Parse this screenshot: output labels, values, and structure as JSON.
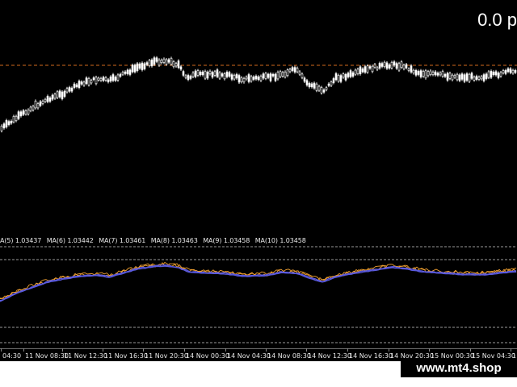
{
  "profit_label": "0.0 p",
  "ma_legend": [
    "A(5) 1.03437",
    "MA(6) 1.03442",
    "MA(7) 1.03461",
    "MA(8) 1.03463",
    "MA(9) 1.03458",
    "MA(10) 1.03458"
  ],
  "time_axis": [
    "04:30",
    "11 Nov 08:30",
    "11 Nov 12:30",
    "11 Nov 16:30",
    "11 Nov 20:30",
    "14 Nov 00:30",
    "14 Nov 04:30",
    "14 Nov 08:30",
    "14 Nov 12:30",
    "14 Nov 16:30",
    "14 Nov 20:30",
    "15 Nov 00:30",
    "15 Nov 04:30",
    "1"
  ],
  "watermark": "www.mt4.shop",
  "colors": {
    "background": "#000000",
    "candle": "#ffffff",
    "price_line": "#d26a1e",
    "ma_orange": "#f0a030",
    "ma_blue": "#5a5ae0",
    "level_lines": "#9a9a9a"
  }
}
